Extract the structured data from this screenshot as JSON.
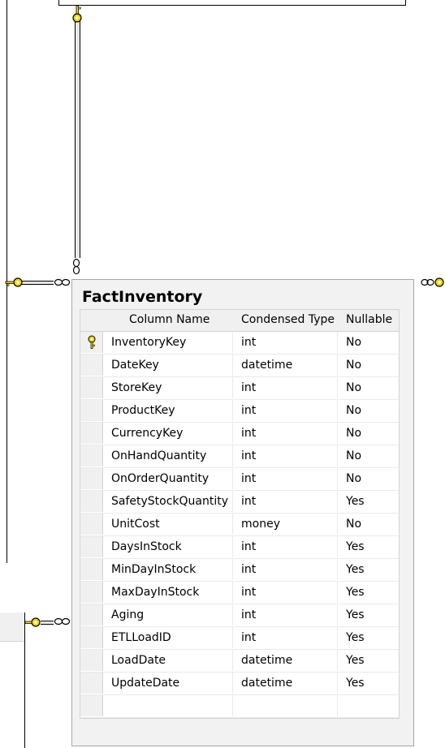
{
  "table": {
    "title": "FactInventory",
    "headers": {
      "name": "Column Name",
      "type": "Condensed Type",
      "nullable": "Nullable"
    },
    "rows": [
      {
        "name": "InventoryKey",
        "type": "int",
        "nullable": "No",
        "primary_key": true
      },
      {
        "name": "DateKey",
        "type": "datetime",
        "nullable": "No"
      },
      {
        "name": "StoreKey",
        "type": "int",
        "nullable": "No"
      },
      {
        "name": "ProductKey",
        "type": "int",
        "nullable": "No"
      },
      {
        "name": "CurrencyKey",
        "type": "int",
        "nullable": "No"
      },
      {
        "name": "OnHandQuantity",
        "type": "int",
        "nullable": "No"
      },
      {
        "name": "OnOrderQuantity",
        "type": "int",
        "nullable": "No"
      },
      {
        "name": "SafetyStockQuantity",
        "type": "int",
        "nullable": "Yes"
      },
      {
        "name": "UnitCost",
        "type": "money",
        "nullable": "No"
      },
      {
        "name": "DaysInStock",
        "type": "int",
        "nullable": "Yes"
      },
      {
        "name": "MinDayInStock",
        "type": "int",
        "nullable": "Yes"
      },
      {
        "name": "MaxDayInStock",
        "type": "int",
        "nullable": "Yes"
      },
      {
        "name": "Aging",
        "type": "int",
        "nullable": "Yes"
      },
      {
        "name": "ETLLoadID",
        "type": "int",
        "nullable": "Yes"
      },
      {
        "name": "LoadDate",
        "type": "datetime",
        "nullable": "Yes"
      },
      {
        "name": "UpdateDate",
        "type": "datetime",
        "nullable": "Yes"
      },
      {
        "name": "",
        "type": "",
        "nullable": ""
      }
    ]
  },
  "colors": {
    "key_icon": "#f2d600",
    "panel": "#f2f2f2",
    "grid_border": "#d4d4d4"
  }
}
